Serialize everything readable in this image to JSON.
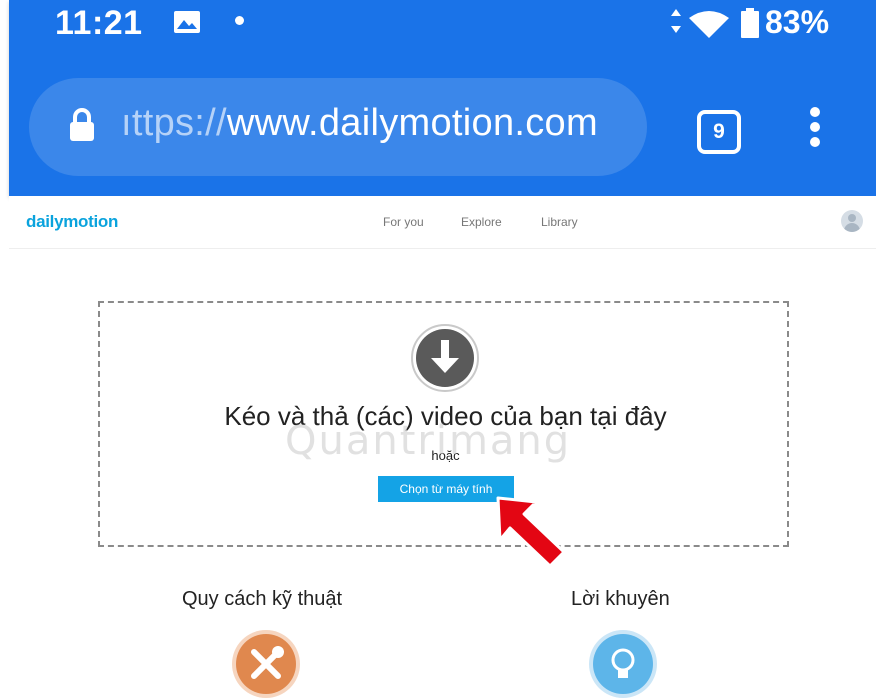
{
  "status_bar": {
    "time": "11:21",
    "battery": "83%",
    "icons": [
      "image-icon",
      "notification-dot",
      "data-arrows-icon",
      "wifi-icon",
      "battery-icon"
    ]
  },
  "browser": {
    "url_scheme": "ıttps://",
    "url_host": "www.dailymotion.com",
    "tab_count": "9",
    "icons": [
      "lock-icon",
      "tabs-icon",
      "overflow-menu-icon"
    ],
    "theme_color": "#1a73e8"
  },
  "site": {
    "logo": "dailymotion",
    "nav": {
      "for_you": "For you",
      "explore": "Explore",
      "library": "Library"
    },
    "accent_color": "#0aa3dd"
  },
  "upload": {
    "title": "Kéo và thả (các) video của bạn tại đây",
    "or": "hoặc",
    "choose_button": "Chọn từ máy tính",
    "button_color": "#14a3e6"
  },
  "watermark": "Quantrimang",
  "sections": {
    "specs": "Quy cách kỹ thuật",
    "tips": "Lời khuyên"
  }
}
